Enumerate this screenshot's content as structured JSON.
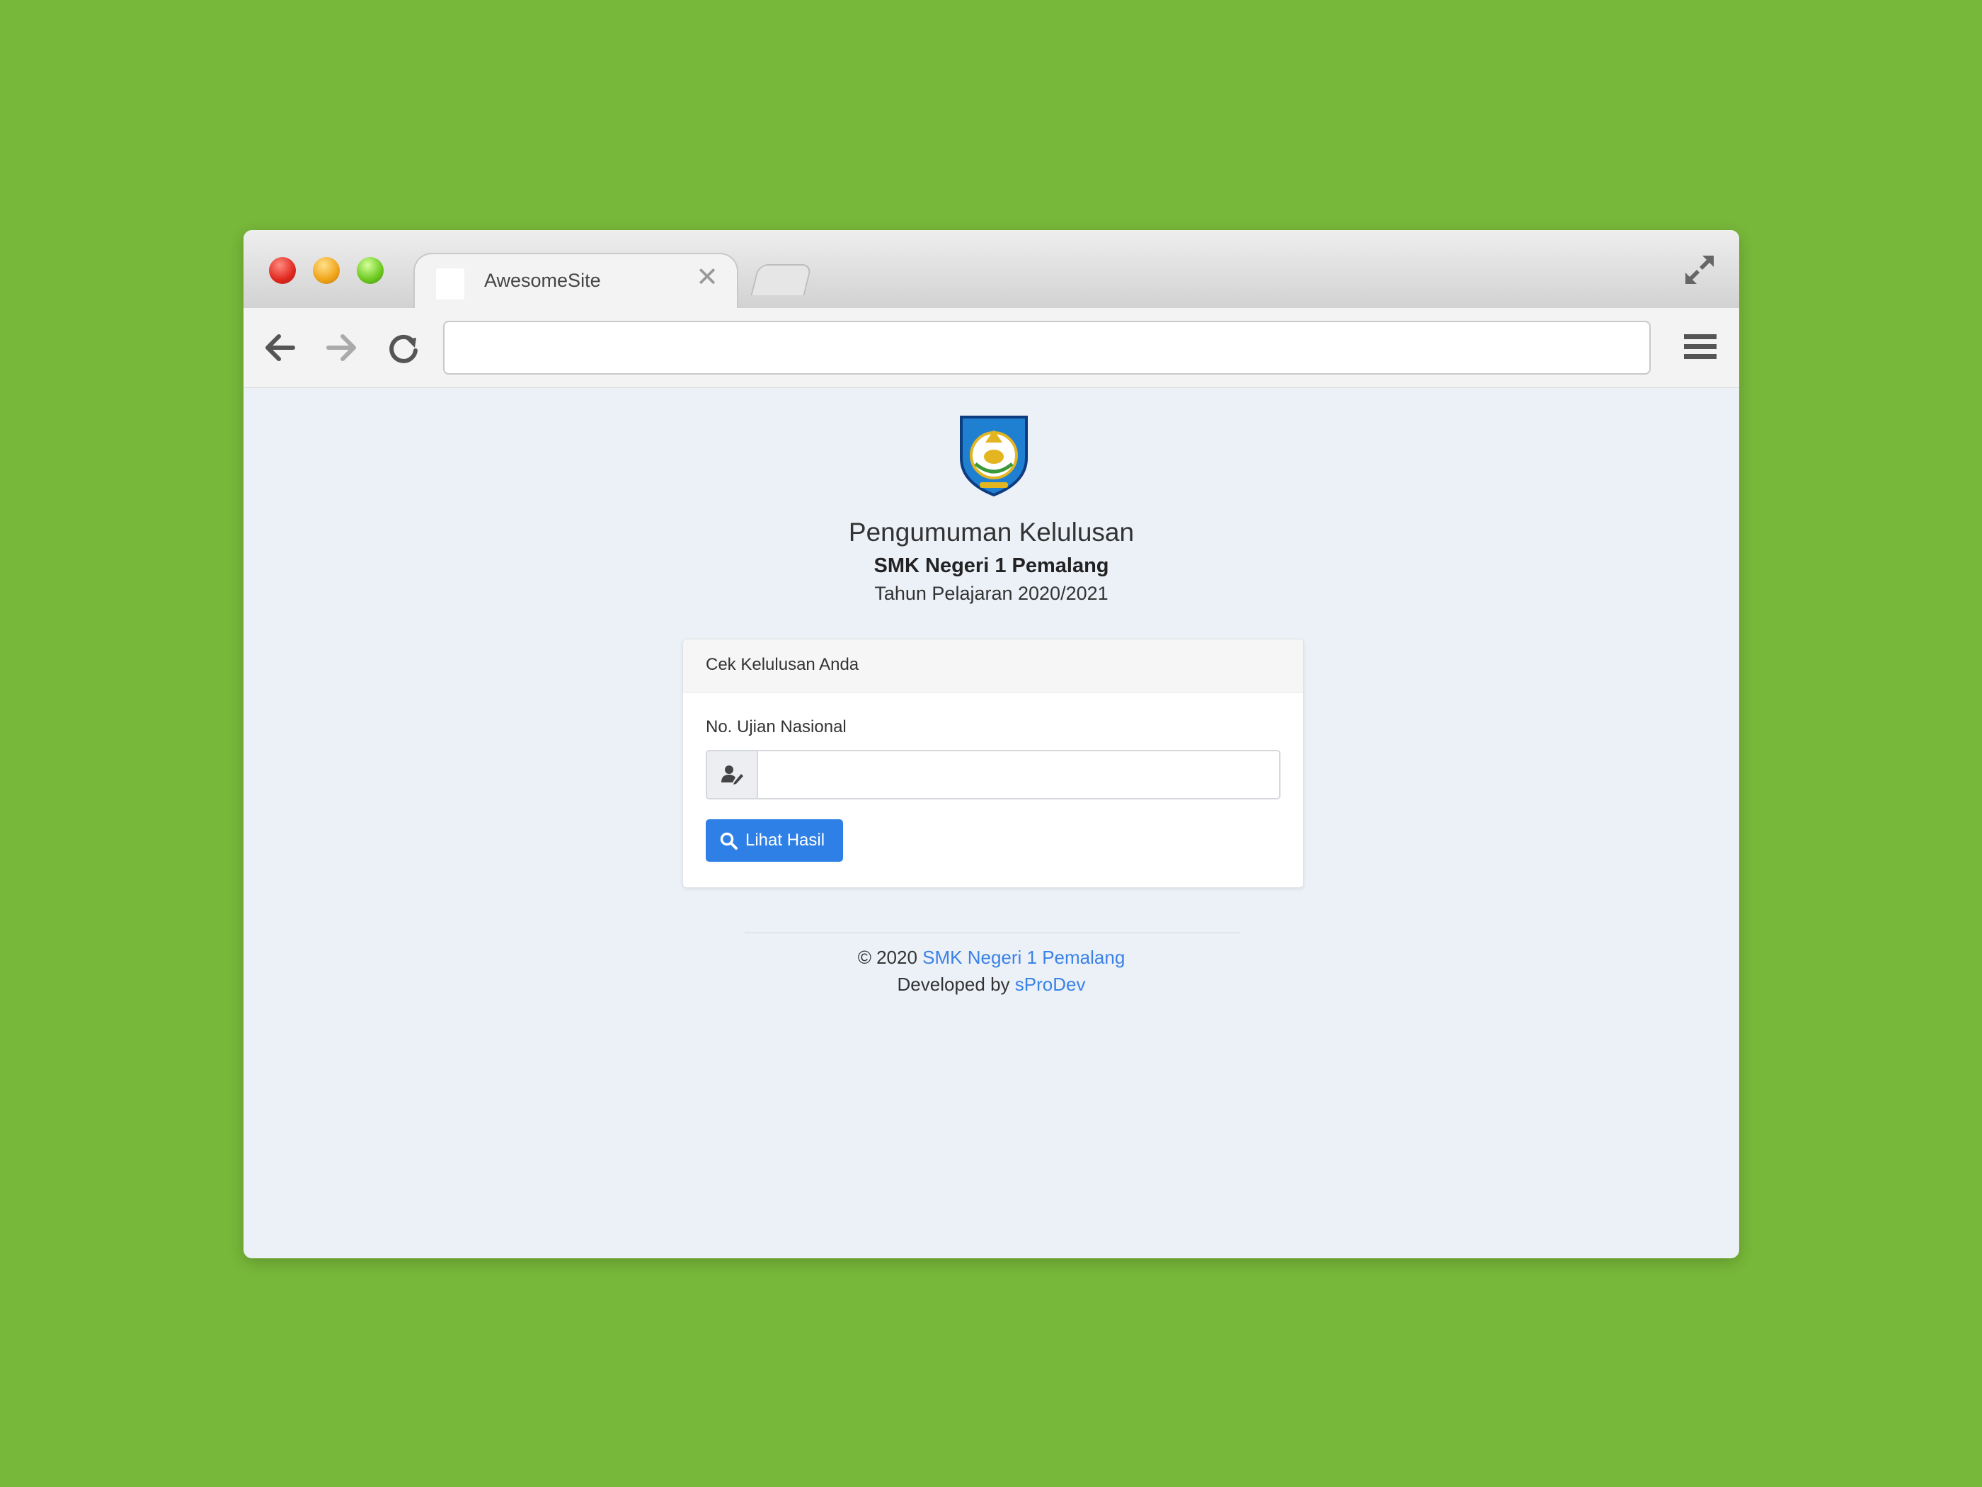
{
  "browser": {
    "tab_title": "AwesomeSite",
    "tab_close": "✕"
  },
  "page": {
    "title": "Pengumuman Kelulusan",
    "school": "SMK Negeri 1 Pemalang",
    "year": "Tahun Pelajaran 2020/2021"
  },
  "card": {
    "header": "Cek Kelulusan Anda",
    "field_label": "No. Ujian Nasional",
    "input_value": "",
    "button_label": "Lihat Hasil"
  },
  "footer": {
    "copyright": "© 2020",
    "school_link": "SMK Negeri 1 Pemalang",
    "developed_by": "Developed by",
    "dev_link": "sProDev"
  },
  "icons": {
    "back": "arrow-left-icon",
    "forward": "arrow-right-icon",
    "reload": "reload-icon",
    "menu": "hamburger-menu-icon",
    "fullscreen": "expand-icon",
    "user_edit": "user-edit-icon",
    "search": "search-icon"
  },
  "colors": {
    "background": "#77b739",
    "page": "#ecf1f8",
    "primary_button": "#2f80e6",
    "link": "#3b82e6"
  }
}
